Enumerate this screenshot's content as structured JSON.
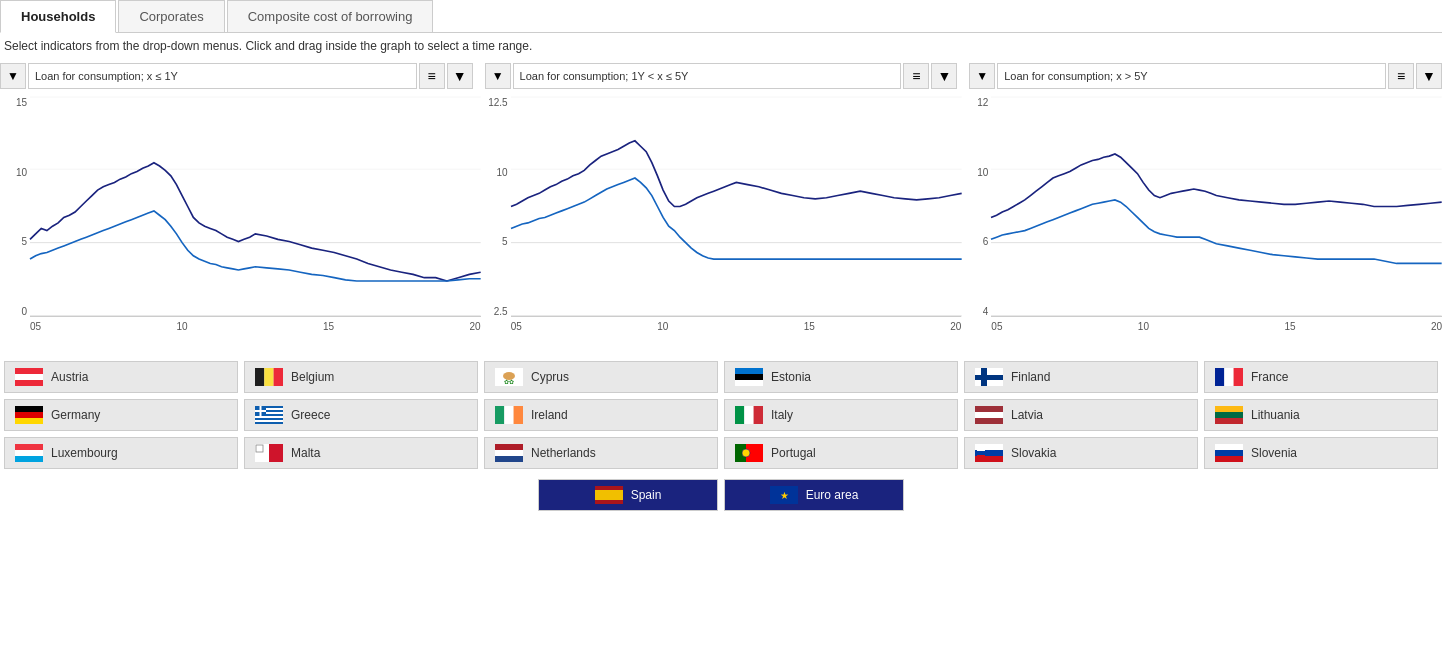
{
  "tabs": [
    {
      "id": "households",
      "label": "Households",
      "active": true
    },
    {
      "id": "corporates",
      "label": "Corporates",
      "active": false
    },
    {
      "id": "composite",
      "label": "Composite cost of borrowing",
      "active": false
    }
  ],
  "instruction": "Select indicators from the drop-down menus. Click and drag inside the graph to select a time range.",
  "charts": [
    {
      "id": "chart1",
      "dropdown_label": "Loan for consumption; x ≤ 1Y",
      "y_labels": [
        "15",
        "10",
        "5",
        "0"
      ],
      "x_labels": [
        "05",
        "10",
        "15",
        "20"
      ],
      "gridlines": [
        0,
        33,
        66,
        100
      ]
    },
    {
      "id": "chart2",
      "dropdown_label": "Loan for consumption; 1Y < x ≤ 5Y",
      "y_labels": [
        "12.5",
        "10",
        "5",
        "2.5"
      ],
      "x_labels": [
        "05",
        "10",
        "15",
        "20"
      ],
      "gridlines": [
        0,
        33,
        66,
        100
      ]
    },
    {
      "id": "chart3",
      "dropdown_label": "Loan for consumption; x > 5Y",
      "y_labels": [
        "12",
        "10",
        "6",
        "4"
      ],
      "x_labels": [
        "05",
        "10",
        "15",
        "20"
      ],
      "gridlines": [
        0,
        33,
        66,
        100
      ]
    }
  ],
  "countries": [
    {
      "id": "austria",
      "label": "Austria",
      "flag": "austria"
    },
    {
      "id": "belgium",
      "label": "Belgium",
      "flag": "belgium"
    },
    {
      "id": "cyprus",
      "label": "Cyprus",
      "flag": "cyprus"
    },
    {
      "id": "estonia",
      "label": "Estonia",
      "flag": "estonia"
    },
    {
      "id": "finland",
      "label": "Finland",
      "flag": "finland"
    },
    {
      "id": "france",
      "label": "France",
      "flag": "france"
    },
    {
      "id": "germany",
      "label": "Germany",
      "flag": "germany"
    },
    {
      "id": "greece",
      "label": "Greece",
      "flag": "greece"
    },
    {
      "id": "ireland",
      "label": "Ireland",
      "flag": "ireland"
    },
    {
      "id": "italy",
      "label": "Italy",
      "flag": "italy"
    },
    {
      "id": "latvia",
      "label": "Latvia",
      "flag": "latvia"
    },
    {
      "id": "lithuania",
      "label": "Lithuania",
      "flag": "lithuania"
    },
    {
      "id": "luxembourg",
      "label": "Luxembourg",
      "flag": "luxembourg"
    },
    {
      "id": "malta",
      "label": "Malta",
      "flag": "malta"
    },
    {
      "id": "netherlands",
      "label": "Netherlands",
      "flag": "netherlands"
    },
    {
      "id": "portugal",
      "label": "Portugal",
      "flag": "portugal"
    },
    {
      "id": "slovakia",
      "label": "Slovakia",
      "flag": "slovakia"
    },
    {
      "id": "slovenia",
      "label": "Slovenia",
      "flag": "slovenia"
    }
  ],
  "bottom_buttons": [
    {
      "id": "spain",
      "label": "Spain",
      "flag": "spain",
      "active": true
    },
    {
      "id": "euro_area",
      "label": "Euro area",
      "flag": "eu",
      "active": true
    }
  ],
  "icons": {
    "dropdown": "▼",
    "table": "≡",
    "chevron_down": "▾"
  }
}
